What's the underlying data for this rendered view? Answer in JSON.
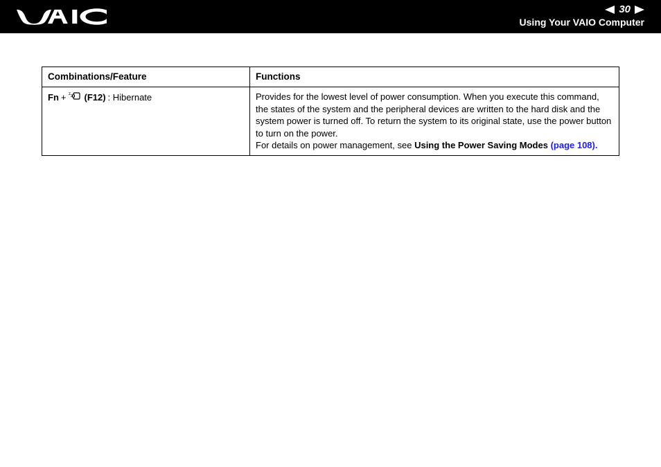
{
  "header": {
    "logo_alt": "VAIO",
    "page_number": "30",
    "section_title": "Using Your VAIO Computer"
  },
  "table": {
    "headers": {
      "combo": "Combinations/Feature",
      "func": "Functions"
    },
    "row": {
      "combo": {
        "fn": "Fn",
        "plus": " + ",
        "f12": "(F12)",
        "label": ": Hibernate",
        "icon_name": "hibernate-icon"
      },
      "func": {
        "body": "Provides for the lowest level of power consumption. When you execute this command, the states of the system and the peripheral devices are written to the hard disk and the system power is turned off. To return the system to its original state, use the power button to turn on the power.",
        "details_prefix": "For details on power management, see ",
        "details_bold": "Using the Power Saving Modes ",
        "details_link": "(page 108)",
        "details_period": "."
      }
    }
  }
}
